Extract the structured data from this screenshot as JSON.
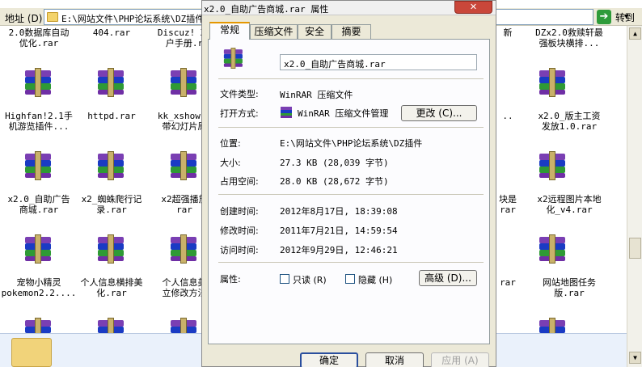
{
  "explorer": {
    "address_label": "地址 (D)",
    "address_path": "E:\\网站文件\\PHP论坛系统\\DZ插件",
    "go_label": "转到"
  },
  "files": [
    {
      "line1": "2.0数据库自动",
      "line2": "优化.rar"
    },
    {
      "line1": "404.rar",
      "line2": ""
    },
    {
      "line1": "Discuz! X1",
      "line2": "户手册.r"
    },
    {
      "line1": "新",
      "line2": ""
    },
    {
      "line1": "DZx2.0救赎轩最",
      "line2": "强板块横排..."
    },
    {
      "line1": "Highfan!2.1手",
      "line2": "机游览插件..."
    },
    {
      "line1": "httpd.rar",
      "line2": ""
    },
    {
      "line1": "kk_xshow D",
      "line2": "带幻灯片原"
    },
    {
      "line1": "..",
      "line2": ""
    },
    {
      "line1": "x2.0_版主工资",
      "line2": "发放1.0.rar"
    },
    {
      "line1": "x2.0_自助广告",
      "line2": "商城.rar"
    },
    {
      "line1": "x2_蜘蛛爬行记",
      "line2": "录.rar"
    },
    {
      "line1": "x2超强播放",
      "line2": "rar"
    },
    {
      "line1": "块是",
      "line2": "rar"
    },
    {
      "line1": "x2远程图片本地",
      "line2": "化_v4.rar"
    },
    {
      "line1": "宠物小精灵",
      "line2": "pokemon2.2...."
    },
    {
      "line1": "个人信息横排美",
      "line2": "化.rar"
    },
    {
      "line1": "个人信息美",
      "line2": "立修改方法"
    },
    {
      "line1": "rar",
      "line2": ""
    },
    {
      "line1": "网站地图任务",
      "line2": "版.rar"
    }
  ],
  "dialog": {
    "title": "x2.0_自助广告商城.rar 属性",
    "close": "✕",
    "tabs": [
      "常规",
      "压缩文件",
      "安全",
      "摘要"
    ],
    "filename": "x2.0_自助广告商城.rar",
    "file_type_label": "文件类型:",
    "file_type": "WinRAR 压缩文件",
    "open_with_label": "打开方式:",
    "open_with": "WinRAR 压缩文件管理",
    "change_button": "更改 (C)...",
    "location_label": "位置:",
    "location": "E:\\网站文件\\PHP论坛系统\\DZ插件",
    "size_label": "大小:",
    "size": "27.3 KB (28,039 字节)",
    "disk_size_label": "占用空间:",
    "disk_size": "28.0 KB (28,672 字节)",
    "created_label": "创建时间:",
    "created": "2012年8月17日, 18:39:08",
    "modified_label": "修改时间:",
    "modified": "2011年7月21日, 14:59:54",
    "accessed_label": "访问时间:",
    "accessed": "2012年9月29日, 12:46:21",
    "attributes_label": "属性:",
    "readonly_label": "只读 (R)",
    "hidden_label": "隐藏 (H)",
    "advanced_button": "高级 (D)...",
    "ok_button": "确定",
    "cancel_button": "取消",
    "apply_button": "应用 (A)"
  }
}
